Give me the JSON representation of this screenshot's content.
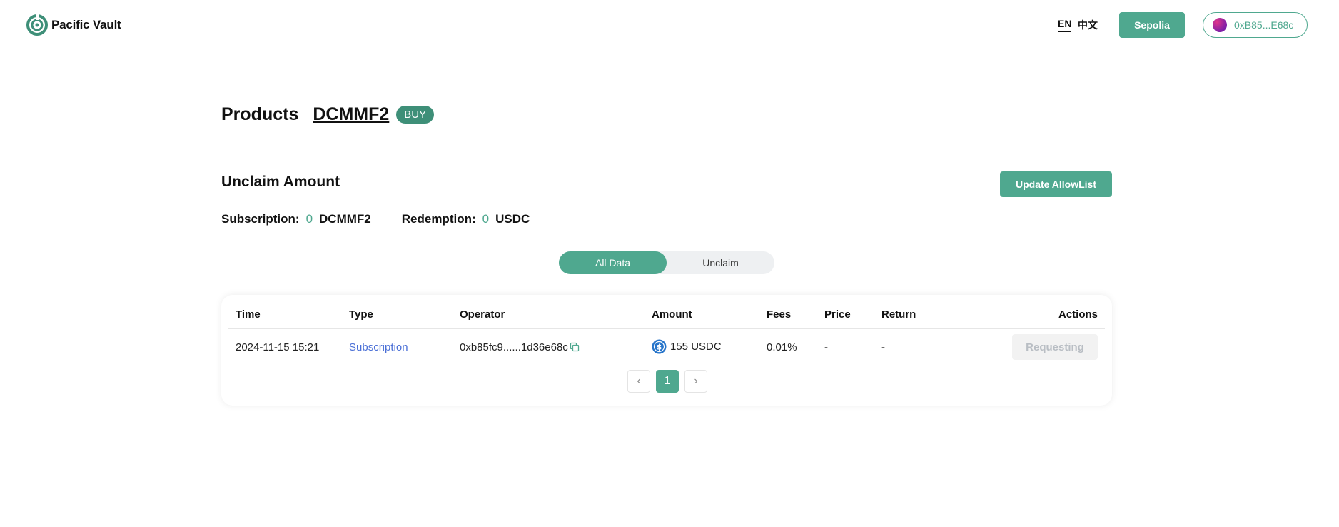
{
  "header": {
    "brand": "Pacific Vault",
    "lang_en": "EN",
    "lang_zh": "中文",
    "network": "Sepolia",
    "wallet": "0xB85...E68c",
    "accent_color": "#4fa88f"
  },
  "page": {
    "title": "Products",
    "product": "DCMMF2",
    "badge": "BUY"
  },
  "unclaim": {
    "title": "Unclaim Amount",
    "update_button": "Update AllowList",
    "subscription_label": "Subscription:",
    "subscription_value": "0",
    "subscription_unit": "DCMMF2",
    "redemption_label": "Redemption:",
    "redemption_value": "0",
    "redemption_unit": "USDC"
  },
  "tabs": {
    "all": "All Data",
    "unclaim": "Unclaim",
    "active": "all"
  },
  "table": {
    "columns": {
      "time": "Time",
      "type": "Type",
      "operator": "Operator",
      "amount": "Amount",
      "fees": "Fees",
      "price": "Price",
      "return": "Return",
      "actions": "Actions"
    },
    "rows": [
      {
        "time": "2024-11-15 15:21",
        "type": "Subscription",
        "operator": "0xb85fc9......1d36e68c",
        "amount": "155",
        "amount_unit": "USDC",
        "amount_icon": "usdc-icon",
        "fees": "0.01%",
        "price": "-",
        "return": "-",
        "action": "Requesting"
      }
    ]
  },
  "pagination": {
    "prev": "‹",
    "current": "1",
    "next": "›"
  }
}
